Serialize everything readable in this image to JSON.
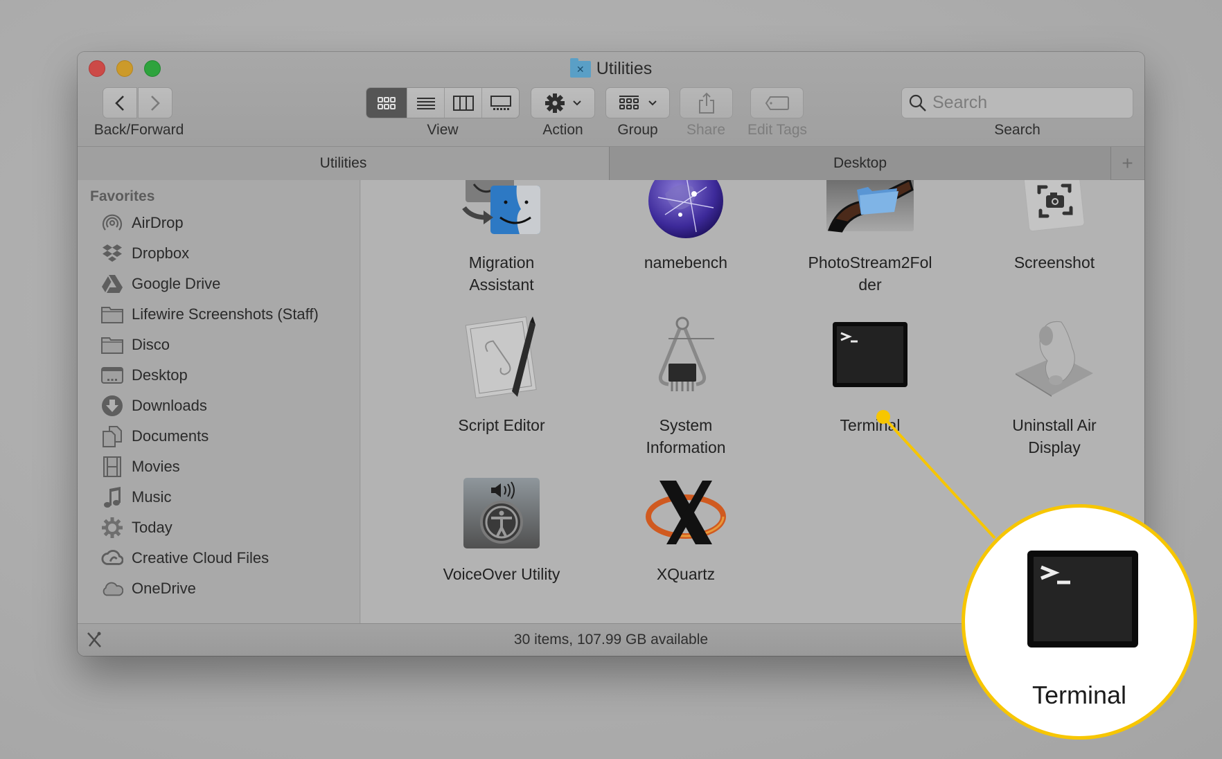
{
  "window": {
    "title": "Utilities",
    "title_icon": "utilities-folder-icon"
  },
  "toolbar": {
    "back_forward_label": "Back/Forward",
    "view_label": "View",
    "view_modes": [
      {
        "name": "icon-view",
        "selected": true
      },
      {
        "name": "list-view",
        "selected": false
      },
      {
        "name": "column-view",
        "selected": false
      },
      {
        "name": "gallery-view",
        "selected": false
      }
    ],
    "action_label": "Action",
    "group_label": "Group",
    "share_label": "Share",
    "edit_tags_label": "Edit Tags",
    "search_label": "Search",
    "search_placeholder": "Search",
    "search_value": ""
  },
  "tabs": [
    {
      "label": "Utilities",
      "active": true
    },
    {
      "label": "Desktop",
      "active": false
    }
  ],
  "tab_add_symbol": "+",
  "sidebar": {
    "heading": "Favorites",
    "items": [
      {
        "label": "AirDrop",
        "icon": "airdrop-icon"
      },
      {
        "label": "Dropbox",
        "icon": "dropbox-icon"
      },
      {
        "label": "Google Drive",
        "icon": "google-drive-icon"
      },
      {
        "label": "Lifewire Screenshots (Staff)",
        "icon": "folder-icon"
      },
      {
        "label": "Disco",
        "icon": "folder-icon"
      },
      {
        "label": "Desktop",
        "icon": "desktop-icon"
      },
      {
        "label": "Downloads",
        "icon": "downloads-icon"
      },
      {
        "label": "Documents",
        "icon": "documents-icon"
      },
      {
        "label": "Movies",
        "icon": "movies-icon"
      },
      {
        "label": "Music",
        "icon": "music-icon"
      },
      {
        "label": "Today",
        "icon": "gear-icon"
      },
      {
        "label": "Creative Cloud Files",
        "icon": "creative-cloud-icon"
      },
      {
        "label": "OneDrive",
        "icon": "onedrive-icon"
      }
    ]
  },
  "files": [
    {
      "label": "Migration Assistant",
      "icon": "migration-assistant-icon"
    },
    {
      "label": "namebench",
      "icon": "namebench-icon"
    },
    {
      "label": "PhotoStream2Folder",
      "icon": "photostream2folder-icon"
    },
    {
      "label": "Screenshot",
      "icon": "screenshot-icon"
    },
    {
      "label": "Script Editor",
      "icon": "script-editor-icon"
    },
    {
      "label": "System Information",
      "icon": "system-information-icon"
    },
    {
      "label": "Terminal",
      "icon": "terminal-icon"
    },
    {
      "label": "Uninstall Air Display",
      "icon": "uninstall-air-display-icon"
    },
    {
      "label": "VoiceOver Utility",
      "icon": "voiceover-utility-icon"
    },
    {
      "label": "XQuartz",
      "icon": "xquartz-icon"
    }
  ],
  "file_label_lines": {
    "0": [
      "Migration",
      "Assistant"
    ],
    "2": [
      "PhotoStream2Fol",
      "der"
    ],
    "5": [
      "System",
      "Information"
    ],
    "7": [
      "Uninstall Air",
      "Display"
    ]
  },
  "status": {
    "text": "30 items, 107.99 GB available"
  },
  "callout": {
    "label": "Terminal",
    "prompt": ">_",
    "accent_color": "#f7c600"
  },
  "colors": {
    "close": "#cc4a47",
    "minimize": "#cc9a2a",
    "zoom": "#2ea33d",
    "selected_view": "#555555"
  }
}
